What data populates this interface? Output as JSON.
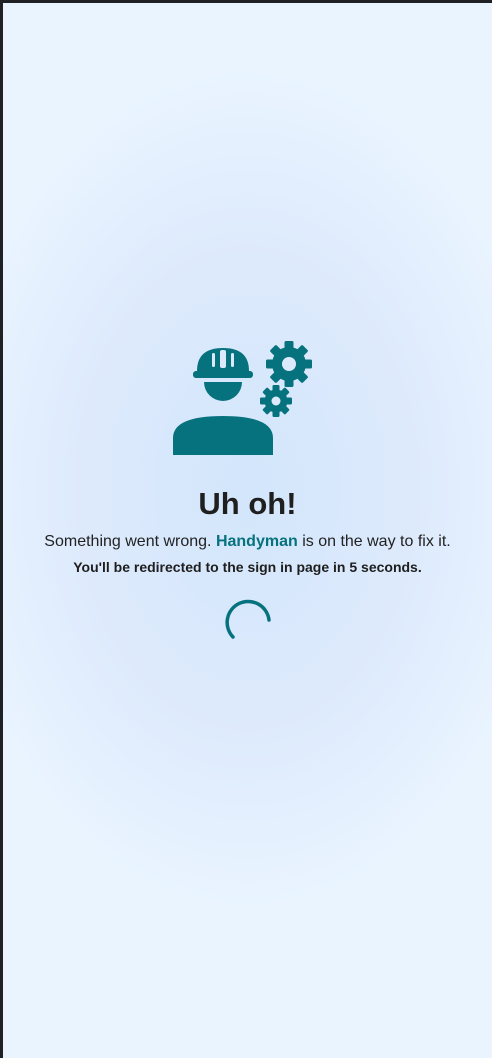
{
  "error": {
    "illustration_icon": "worker-with-gears-icon",
    "title": "Uh oh!",
    "message_before": "Something went wrong. ",
    "brand_name": "Handyman",
    "message_after": " is on the way to fix it.",
    "redirect_prefix": "You'll be redirected to the sign in page in ",
    "redirect_seconds": "5",
    "redirect_suffix": " seconds.",
    "spinner_icon": "loading-spinner-icon"
  },
  "colors": {
    "accent": "#06727e",
    "text": "#1e1e1e",
    "background": "#ddeafc"
  }
}
